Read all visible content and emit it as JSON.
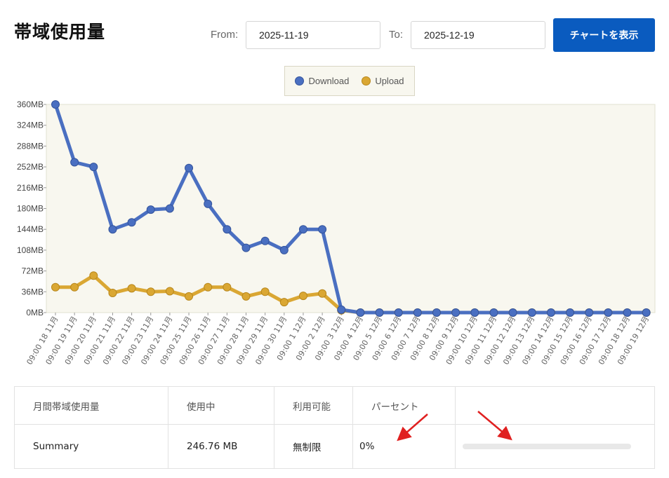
{
  "page": {
    "title": "帯域使用量"
  },
  "filter": {
    "from_label": "From:",
    "from_value": "2025-11-19",
    "to_label": "To:",
    "to_value": "2025-12-19",
    "show_button": "チャートを表示"
  },
  "colors": {
    "download": "#4a6fc1",
    "upload": "#daa733",
    "button": "#0a5bbf",
    "annotation_arrow": "#e02020"
  },
  "chart_data": {
    "type": "line",
    "legend_position": "top-center",
    "grid": false,
    "ylim": [
      0,
      360
    ],
    "y_ticks": [
      "0MB",
      "36MB",
      "72MB",
      "108MB",
      "144MB",
      "180MB",
      "216MB",
      "252MB",
      "288MB",
      "324MB",
      "360MB"
    ],
    "x": [
      "09:00 18 11月",
      "09:00 19 11月",
      "09:00 20 11月",
      "09:00 21 11月",
      "09:00 22 11月",
      "09:00 23 11月",
      "09:00 24 11月",
      "09:00 25 11月",
      "09:00 26 11月",
      "09:00 27 11月",
      "09:00 28 11月",
      "09:00 29 11月",
      "09:00 30 11月",
      "09:00 1 12月",
      "09:00 2 12月",
      "09:00 3 12月",
      "09:00 4 12月",
      "09:00 5 12月",
      "09:00 6 12月",
      "09:00 7 12月",
      "09:00 8 12月",
      "09:00 9 12月",
      "09:00 10 12月",
      "09:00 11 12月",
      "09:00 12 12月",
      "09:00 13 12月",
      "09:00 14 12月",
      "09:00 15 12月",
      "09:00 16 12月",
      "09:00 17 12月",
      "09:00 18 12月",
      "09:00 19 12月"
    ],
    "series": [
      {
        "name": "Download",
        "values": [
          360,
          260,
          252,
          144,
          156,
          178,
          180,
          250,
          188,
          144,
          112,
          124,
          108,
          144,
          144,
          5,
          0,
          0,
          0,
          0,
          0,
          0,
          0,
          0,
          0,
          0,
          0,
          0,
          0,
          0,
          0,
          0
        ]
      },
      {
        "name": "Upload",
        "values": [
          44,
          44,
          64,
          34,
          42,
          36,
          37,
          28,
          44,
          44,
          28,
          36,
          18,
          29,
          33,
          4,
          0,
          0,
          0,
          0,
          0,
          0,
          0,
          0,
          0,
          0,
          0,
          0,
          0,
          0,
          0,
          0
        ]
      }
    ]
  },
  "summary": {
    "headers": [
      "月間帯域使用量",
      "使用中",
      "利用可能",
      "パーセント",
      ""
    ],
    "row": {
      "name": "Summary",
      "used": "246.76 MB",
      "available": "無制限",
      "percent": "0%"
    },
    "progress": 0
  }
}
